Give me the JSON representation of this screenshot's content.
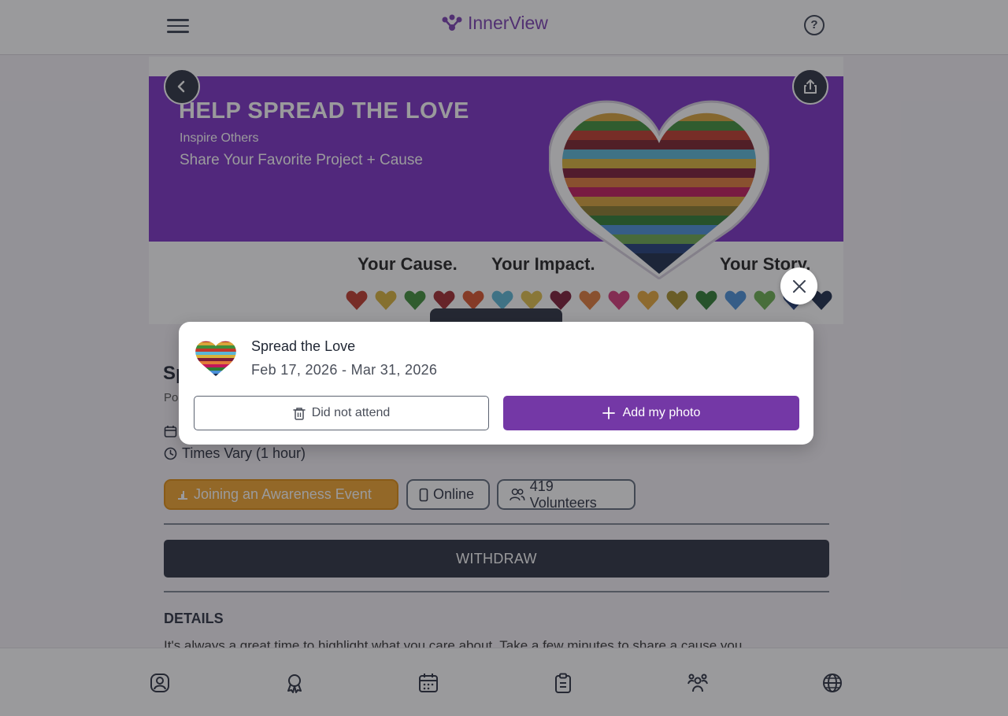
{
  "header": {
    "brand_name": "InnerView",
    "brand_color": "#7b3fb3",
    "help_glyph": "?"
  },
  "hero": {
    "title": "HELP SPREAD THE LOVE",
    "subtitle": "Inspire Others",
    "line2": "Share Your Favorite Project + Cause",
    "tagline_1": "Your Cause.",
    "tagline_2": "Your Impact.",
    "tagline_3": "Your Story.",
    "band_color": "#7a31c5"
  },
  "event": {
    "title_partial": "Sp",
    "subtitle_partial": "Po",
    "time": "Times Vary (1 hour)",
    "chips": {
      "activity": "Joining an Awareness Event",
      "mode": "Online",
      "volunteers": "419 Volunteers"
    },
    "withdraw_label": "WITHDRAW",
    "details_heading": "DETAILS",
    "details_text": "It's always a great time to highlight what you care about. Take a few minutes to share a cause you"
  },
  "modal": {
    "title": "Spread the Love",
    "date_range": "Feb 17, 2026 - Mar 31, 2026",
    "did_not_attend_label": "Did not attend",
    "add_photo_label": "Add my photo",
    "primary_color": "#7438a6"
  },
  "bottom_nav": {
    "icons": [
      "profile-icon",
      "award-icon",
      "calendar-icon",
      "clipboard-icon",
      "community-icon",
      "globe-icon"
    ]
  }
}
